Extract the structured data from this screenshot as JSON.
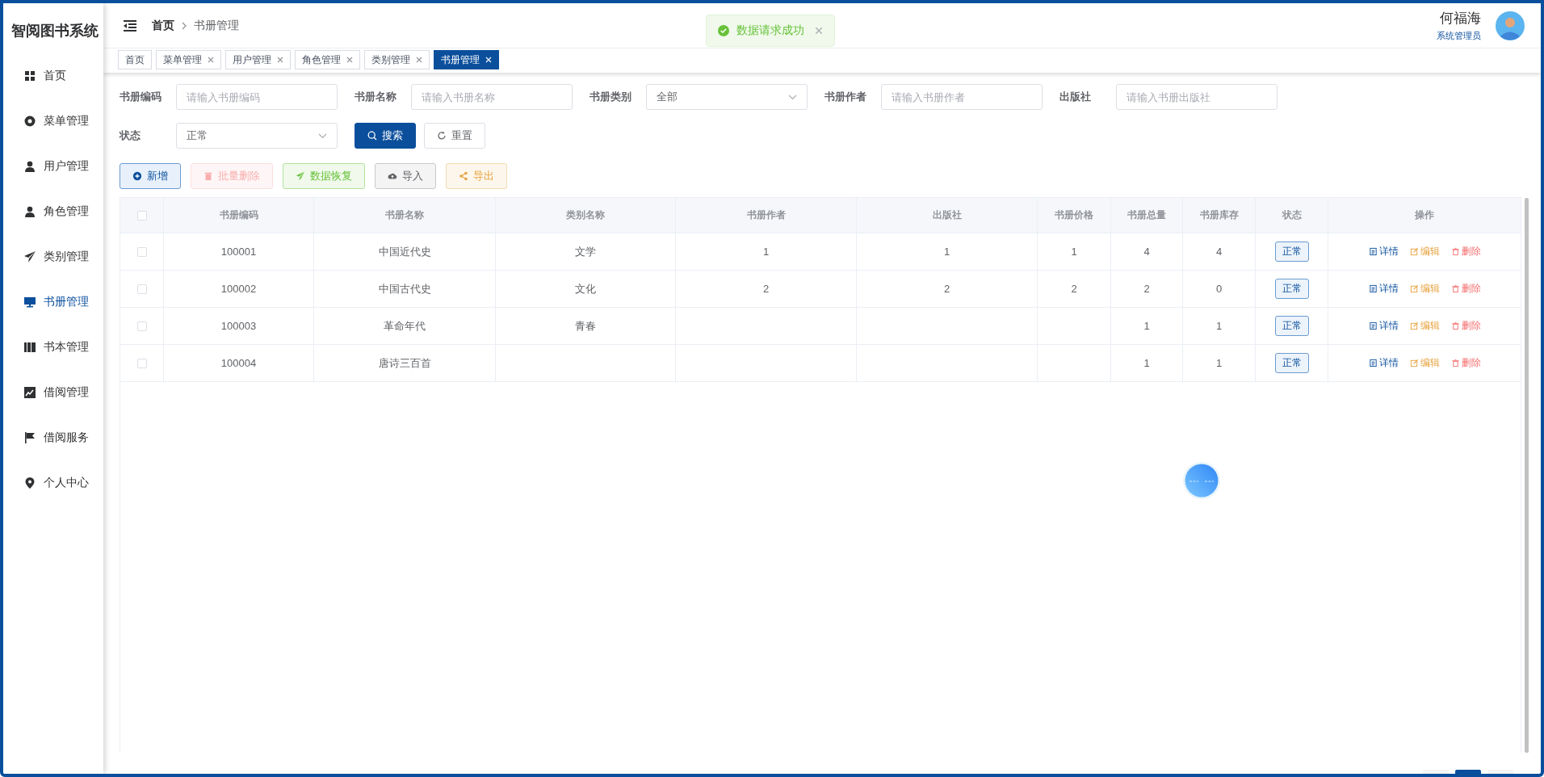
{
  "app_title": "智阅图书系统",
  "sidebar": {
    "items": [
      {
        "label": "首页",
        "selected": false
      },
      {
        "label": "菜单管理",
        "selected": false
      },
      {
        "label": "用户管理",
        "selected": false
      },
      {
        "label": "角色管理",
        "selected": false
      },
      {
        "label": "类别管理",
        "selected": false
      },
      {
        "label": "书册管理",
        "selected": true
      },
      {
        "label": "书本管理",
        "selected": false
      },
      {
        "label": "借阅管理",
        "selected": false
      },
      {
        "label": "借阅服务",
        "selected": false
      },
      {
        "label": "个人中心",
        "selected": false
      }
    ]
  },
  "breadcrumb": [
    "首页",
    "书册管理"
  ],
  "user": {
    "name": "何福海",
    "role": "系统管理员"
  },
  "toast": {
    "message": "数据请求成功"
  },
  "tabs": [
    {
      "label": "首页",
      "closable": false,
      "selected": false
    },
    {
      "label": "菜单管理",
      "closable": true,
      "selected": false
    },
    {
      "label": "用户管理",
      "closable": true,
      "selected": false
    },
    {
      "label": "角色管理",
      "closable": true,
      "selected": false
    },
    {
      "label": "类别管理",
      "closable": true,
      "selected": false
    },
    {
      "label": "书册管理",
      "closable": true,
      "selected": true
    }
  ],
  "filters": [
    {
      "label": "书册编码",
      "kind": "input",
      "placeholder": "请输入书册编码"
    },
    {
      "label": "书册名称",
      "kind": "input",
      "placeholder": "请输入书册名称"
    },
    {
      "label": "书册类别",
      "kind": "select",
      "value": "全部"
    },
    {
      "label": "书册作者",
      "kind": "input",
      "placeholder": "请输入书册作者"
    },
    {
      "label": "出版社",
      "kind": "input",
      "placeholder": "请输入书册出版社"
    },
    {
      "label": "状态",
      "kind": "select",
      "value": "正常"
    }
  ],
  "search_buttons": [
    {
      "label": "搜索",
      "kind": "primary"
    },
    {
      "label": "重置",
      "kind": "plain"
    }
  ],
  "toolbar": [
    {
      "label": "新增",
      "kind": "add",
      "disabled": false
    },
    {
      "label": "批量删除",
      "kind": "delete",
      "disabled": true
    },
    {
      "label": "数据恢复",
      "kind": "restore",
      "disabled": false
    },
    {
      "label": "导入",
      "kind": "import",
      "disabled": false
    },
    {
      "label": "导出",
      "kind": "export",
      "disabled": false
    }
  ],
  "table": {
    "select_all": {
      "checked": false
    },
    "columns": [
      "书册编码",
      "书册名称",
      "类别名称",
      "书册作者",
      "出版社",
      "书册价格",
      "书册总量",
      "书册库存",
      "状态",
      "操作"
    ],
    "rows": [
      {
        "selected": false,
        "cells": [
          "100001",
          "中国近代史",
          "文学",
          "1",
          "1",
          "1",
          "4",
          "4"
        ],
        "status": "正常",
        "actions": [
          {
            "kind": "detail",
            "label": "详情"
          },
          {
            "kind": "edit",
            "label": "编辑"
          },
          {
            "kind": "delete",
            "label": "删除"
          }
        ]
      },
      {
        "selected": false,
        "cells": [
          "100002",
          "中国古代史",
          "文化",
          "2",
          "2",
          "2",
          "2",
          "0"
        ],
        "status": "正常",
        "actions": [
          {
            "kind": "detail",
            "label": "详情"
          },
          {
            "kind": "edit",
            "label": "编辑"
          },
          {
            "kind": "delete",
            "label": "删除"
          }
        ]
      },
      {
        "selected": false,
        "cells": [
          "100003",
          "革命年代",
          "青春",
          "",
          "",
          "",
          "1",
          "1"
        ],
        "status": "正常",
        "actions": [
          {
            "kind": "detail",
            "label": "详情"
          },
          {
            "kind": "edit",
            "label": "编辑"
          },
          {
            "kind": "delete",
            "label": "删除"
          }
        ]
      },
      {
        "selected": false,
        "cells": [
          "100004",
          "唐诗三百首",
          "",
          "",
          "",
          "",
          "1",
          "1"
        ],
        "status": "正常",
        "actions": [
          {
            "kind": "detail",
            "label": "详情"
          },
          {
            "kind": "edit",
            "label": "编辑"
          },
          {
            "kind": "delete",
            "label": "删除"
          }
        ]
      }
    ]
  },
  "pagination": {
    "pages": [
      {
        "selected": false
      },
      {
        "selected": true
      },
      {
        "selected": false
      }
    ]
  }
}
